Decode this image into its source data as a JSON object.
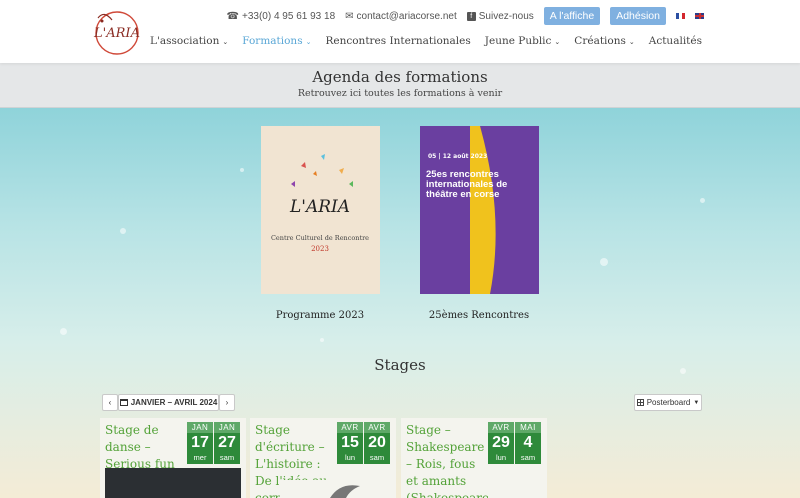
{
  "header": {
    "logo_text": "L'ARIA",
    "phone": "+33(0) 4 95 61 93 18",
    "email": "contact@ariacorse.net",
    "follow": "Suivez-nous",
    "btn_affiche": "A l'affiche",
    "btn_adhesion": "Adhésion",
    "nav": [
      {
        "label": "L'association",
        "dropdown": true
      },
      {
        "label": "Formations",
        "dropdown": true,
        "active": true
      },
      {
        "label": "Rencontres Internationales",
        "dropdown": false
      },
      {
        "label": "Jeune Public",
        "dropdown": true
      },
      {
        "label": "Créations",
        "dropdown": true
      },
      {
        "label": "Actualités",
        "dropdown": false
      }
    ]
  },
  "title": {
    "heading": "Agenda des formations",
    "subheading": "Retrouvez ici toutes les formations à venir"
  },
  "posters": [
    {
      "caption": "Programme 2023",
      "art_title": "L'ARIA",
      "art_sub": "Centre Culturel de Rencontre",
      "art_year": "2023"
    },
    {
      "caption": "25èmes Rencontres",
      "art_date": "05 | 12 août 2023",
      "art_title": "25es rencontres internationales de théâtre en corse"
    }
  ],
  "stages_title": "Stages",
  "toolbar": {
    "prev": "‹",
    "range": "JANVIER – AVRIL 2024",
    "next": "›",
    "view": "Posterboard"
  },
  "cards": [
    {
      "title": "Stage de danse – Serious fun",
      "dates": [
        {
          "m": "JAN",
          "d": "17",
          "w": "mer"
        },
        {
          "m": "JAN",
          "d": "27",
          "w": "sam"
        }
      ]
    },
    {
      "title": "Stage d'écriture – L'histoire : De l'idée au corps",
      "dates": [
        {
          "m": "AVR",
          "d": "15",
          "w": "lun"
        },
        {
          "m": "AVR",
          "d": "20",
          "w": "sam"
        }
      ]
    },
    {
      "title": "Stage – Shakespeare – Rois, fous et amants (Shakespeare – Kings, lunatics and lovers)",
      "dates": [
        {
          "m": "AVR",
          "d": "29",
          "w": "lun"
        },
        {
          "m": "MAI",
          "d": "4",
          "w": "sam"
        }
      ]
    }
  ],
  "colors": {
    "accent": "#5aa7d6",
    "button": "#7fb0e0",
    "green": "#2e8a3a",
    "title_green": "#53a238"
  }
}
